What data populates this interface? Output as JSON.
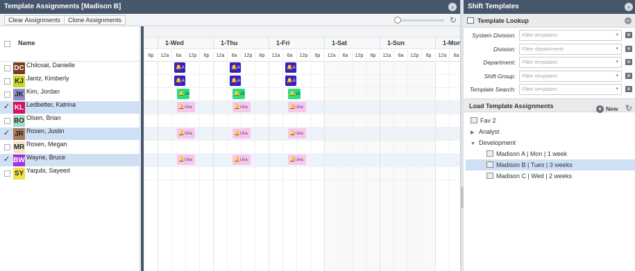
{
  "left_panel": {
    "title": "Template Assignments [Madison B]",
    "toolbar": {
      "clear_label": "Clear Assignments",
      "clone_label": "Clone Assignments"
    },
    "name_header": "Name",
    "employees": [
      {
        "initials": "DC",
        "name": "Chilcoat, Danielle",
        "color": "#7a3b1e",
        "text_color": "#ffffff",
        "checked": false
      },
      {
        "initials": "KJ",
        "name": "Jantz, Kimberly",
        "color": "#c5d42c",
        "text_color": "#222222",
        "checked": false
      },
      {
        "initials": "JK",
        "name": "Kim, Jordan",
        "color": "#8c8fc6",
        "text_color": "#222222",
        "checked": false
      },
      {
        "initials": "KL",
        "name": "Ledbetter, Katrina",
        "color": "#d1145f",
        "text_color": "#ffffff",
        "checked": true
      },
      {
        "initials": "BO",
        "name": "Olsen, Brian",
        "color": "#a6dcc7",
        "text_color": "#222222",
        "checked": false
      },
      {
        "initials": "JR",
        "name": "Rosen, Justin",
        "color": "#a77a60",
        "text_color": "#222222",
        "checked": true
      },
      {
        "initials": "MR",
        "name": "Rosen, Megan",
        "color": "#f3e2c6",
        "text_color": "#222222",
        "checked": false
      },
      {
        "initials": "BW",
        "name": "Wayne, Bruce",
        "color": "#a333d8",
        "text_color": "#ffffff",
        "checked": true
      },
      {
        "initials": "SY",
        "name": "Yaqubi, Sayeed",
        "color": "#f2e246",
        "text_color": "#222222",
        "checked": false
      }
    ],
    "days": [
      "1-Wed",
      "1-Thu",
      "1-Fri",
      "1-Sat",
      "1-Sun",
      "1-Mon"
    ],
    "first_hour_label": "6p",
    "hour_labels": [
      "12a",
      "6a",
      "12p",
      "6p"
    ],
    "shifts": [
      {
        "row": 0,
        "day": 0,
        "type": "blue",
        "label": "A"
      },
      {
        "row": 0,
        "day": 1,
        "type": "blue",
        "label": "A"
      },
      {
        "row": 0,
        "day": 2,
        "type": "blue",
        "label": "A"
      },
      {
        "row": 1,
        "day": 0,
        "type": "blue",
        "label": "A"
      },
      {
        "row": 1,
        "day": 1,
        "type": "blue",
        "label": "A"
      },
      {
        "row": 1,
        "day": 2,
        "type": "blue",
        "label": "A"
      },
      {
        "row": 2,
        "day": 0,
        "type": "green",
        "label": "JA"
      },
      {
        "row": 2,
        "day": 1,
        "type": "green",
        "label": "JA"
      },
      {
        "row": 2,
        "day": 2,
        "type": "green",
        "label": "JA"
      },
      {
        "row": 3,
        "day": 0,
        "type": "pink",
        "label": "Una"
      },
      {
        "row": 3,
        "day": 1,
        "type": "pink",
        "label": "Una"
      },
      {
        "row": 3,
        "day": 2,
        "type": "pink",
        "label": "Una"
      },
      {
        "row": 5,
        "day": 0,
        "type": "pink",
        "label": "Una"
      },
      {
        "row": 5,
        "day": 1,
        "type": "pink",
        "label": "Una"
      },
      {
        "row": 5,
        "day": 2,
        "type": "pink",
        "label": "Una"
      },
      {
        "row": 7,
        "day": 0,
        "type": "pink",
        "label": "Una"
      },
      {
        "row": 7,
        "day": 1,
        "type": "pink",
        "label": "Una"
      },
      {
        "row": 7,
        "day": 2,
        "type": "pink",
        "label": "Una"
      }
    ]
  },
  "right_panel": {
    "title": "Shift Templates",
    "lookup_header": "Template Lookup",
    "filters": [
      {
        "label": "System Division:",
        "placeholder": "Filter templates"
      },
      {
        "label": "Division:",
        "placeholder": "Filter departments"
      },
      {
        "label": "Department:",
        "placeholder": "Filter templates"
      },
      {
        "label": "Shift Group:",
        "placeholder": "Filter templates"
      },
      {
        "label": "Template Search:",
        "placeholder": "Filter templates"
      }
    ],
    "load_header": "Load Template Assignments",
    "new_label": "New",
    "tree": [
      {
        "label": "Fav 2",
        "kind": "item",
        "level": 0,
        "selected": false
      },
      {
        "label": "Analyst",
        "kind": "folder-closed",
        "level": 0,
        "selected": false
      },
      {
        "label": "Development",
        "kind": "folder-open",
        "level": 0,
        "selected": false
      },
      {
        "label": "Madison A | Mon | 1 week",
        "kind": "item",
        "level": 1,
        "selected": false
      },
      {
        "label": "Madison B | Tues | 3 weeks",
        "kind": "item",
        "level": 1,
        "selected": true
      },
      {
        "label": "Madison C | Wed | 2 weeks",
        "kind": "item",
        "level": 1,
        "selected": false
      }
    ]
  }
}
